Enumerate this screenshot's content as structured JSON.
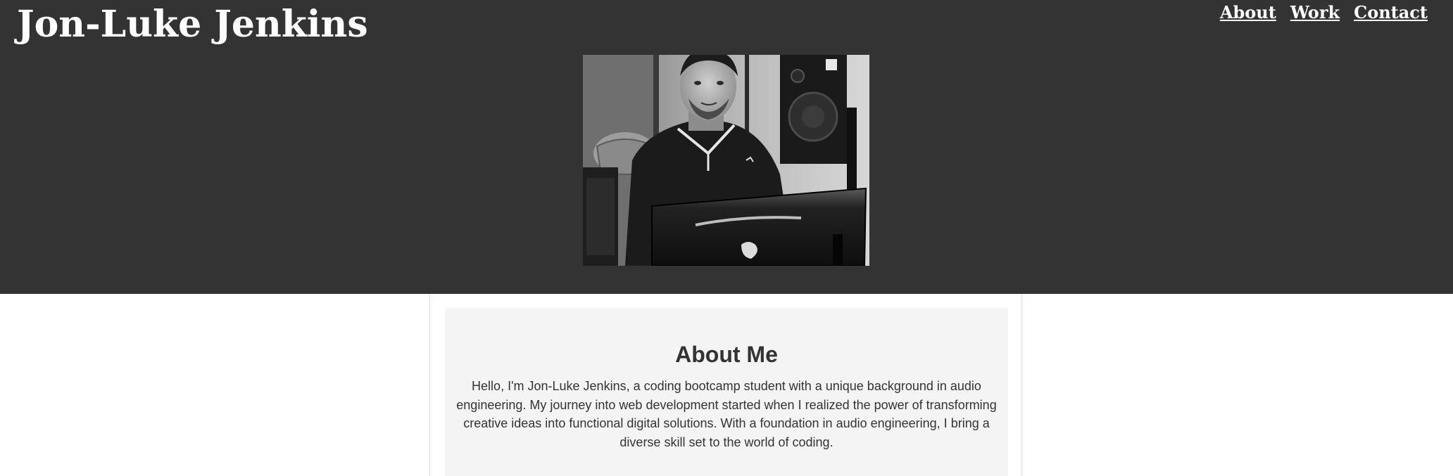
{
  "header": {
    "title": "Jon-Luke Jenkins",
    "nav": [
      {
        "label": "About"
      },
      {
        "label": "Work"
      },
      {
        "label": "Contact"
      }
    ],
    "background_color": "#333333"
  },
  "hero_image": {
    "alt": "Jon-Luke Jenkins"
  },
  "about": {
    "heading": "About Me",
    "body": "Hello, I'm Jon-Luke Jenkins, a coding bootcamp student with a unique background in audio engineering. My journey into web development started when I realized the power of transforming creative ideas into functional digital solutions. With a foundation in audio engineering, I bring a diverse skill set to the world of coding.",
    "card_color": "#f4f4f4"
  }
}
